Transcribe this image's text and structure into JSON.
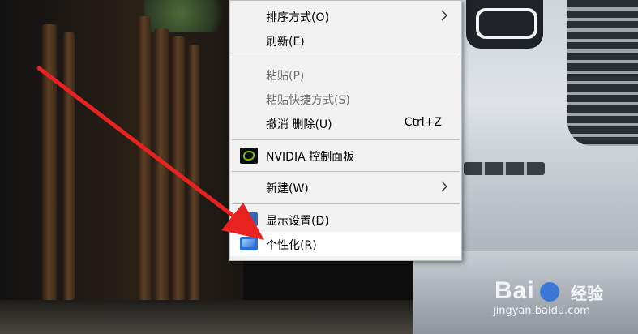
{
  "context_menu": {
    "items": [
      {
        "label": "排序方式(O)",
        "submenu": true
      },
      {
        "label": "刷新(E)"
      },
      {
        "label": "粘贴(P)",
        "disabled": true
      },
      {
        "label": "粘贴快捷方式(S)",
        "disabled": true
      },
      {
        "label": "撤消 删除(U)",
        "shortcut": "Ctrl+Z"
      },
      {
        "label": "NVIDIA 控制面板",
        "icon": "nvidia-icon"
      },
      {
        "label": "新建(W)",
        "submenu": true
      },
      {
        "label": "显示设置(D)",
        "icon": "display-settings-icon"
      },
      {
        "label": "个性化(R)",
        "icon": "personalize-icon",
        "highlighted": true
      }
    ]
  },
  "annotation": {
    "type": "red-arrow",
    "color": "#e8221f",
    "points_to": "个性化(R)"
  },
  "watermark": {
    "brand_left": "Bai",
    "brand_right": "经验",
    "url": "jingyan.baidu.com"
  }
}
